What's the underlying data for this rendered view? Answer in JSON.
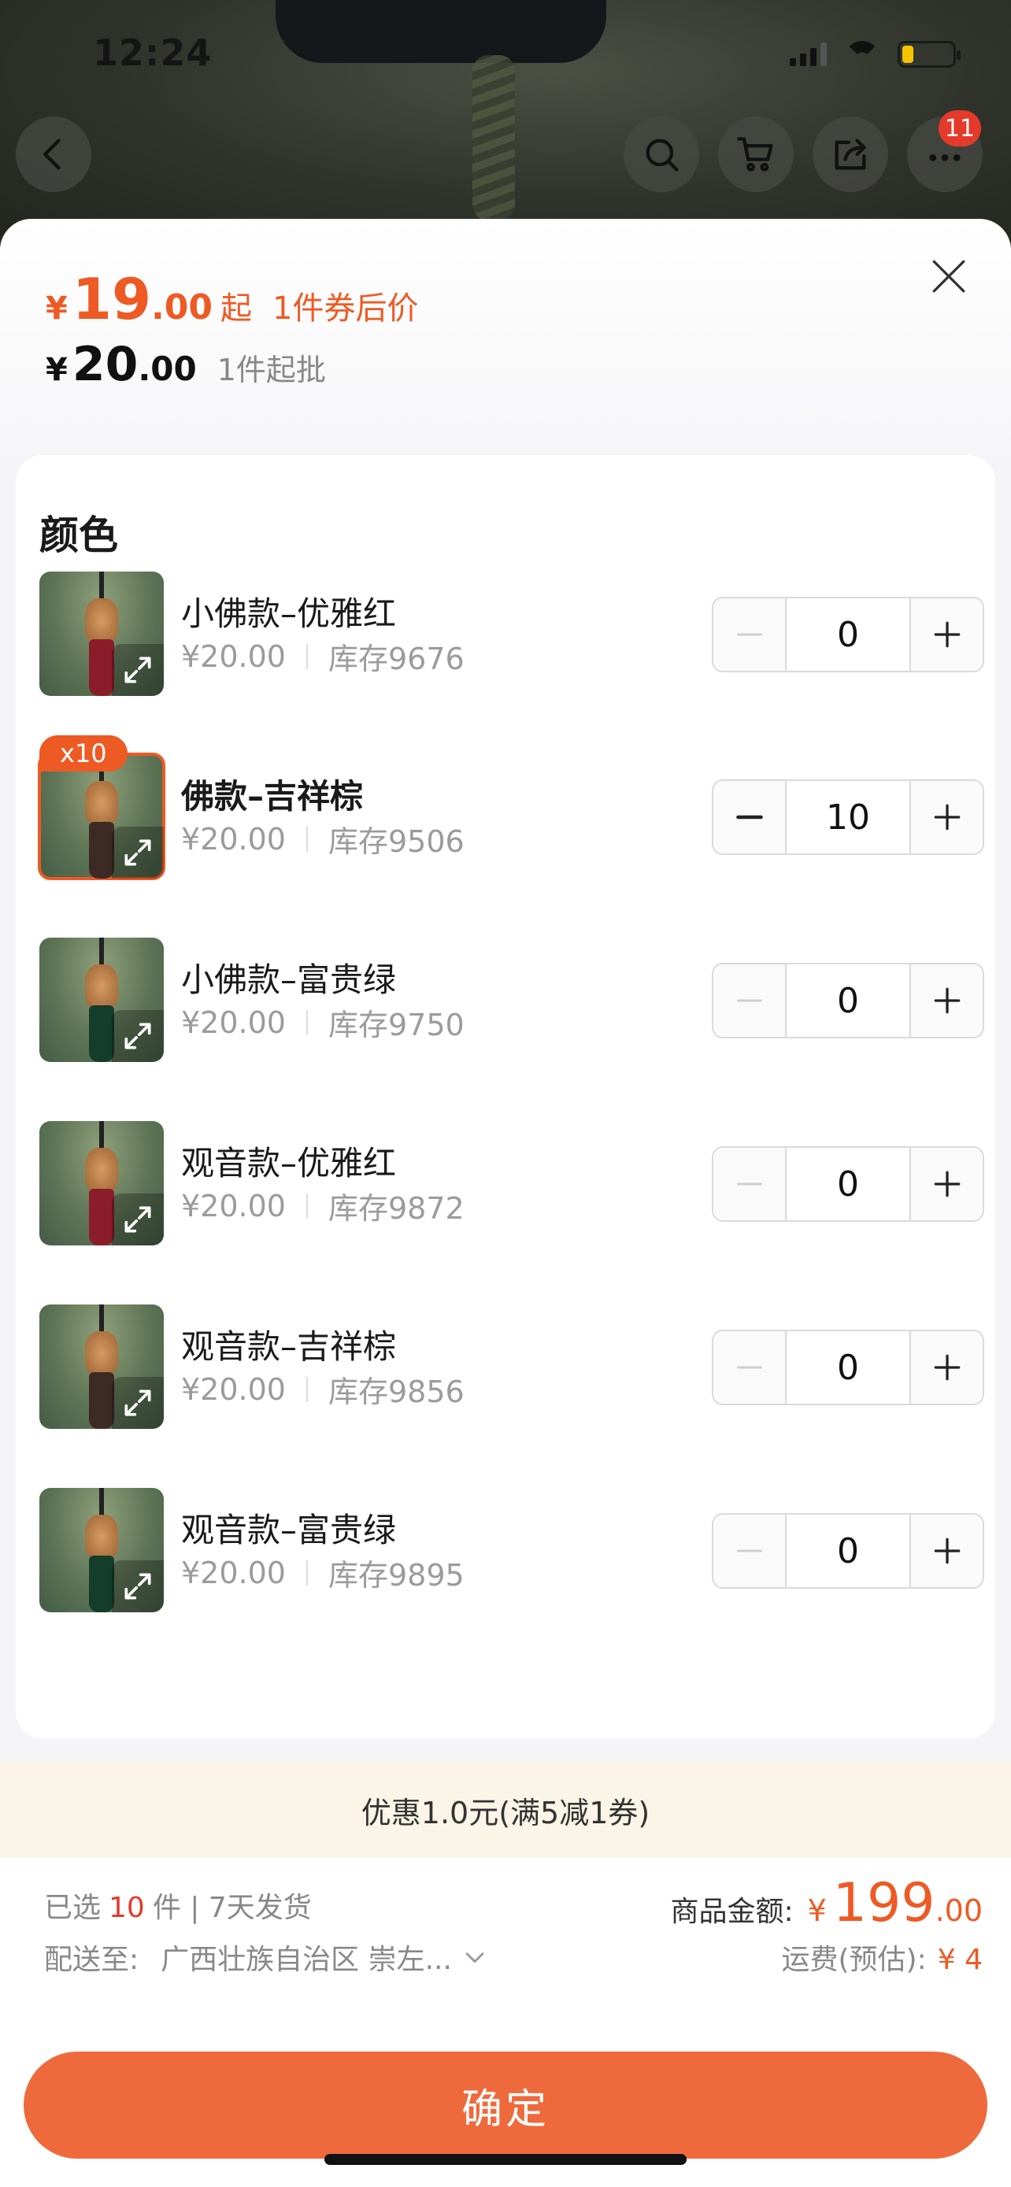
{
  "status_bar": {
    "time": "12:24"
  },
  "top_nav": {
    "back_icon": "chevron-left-icon",
    "search_icon": "search-icon",
    "cart_icon": "cart-icon",
    "share_icon": "share-icon",
    "more_badge": "11"
  },
  "sheet": {
    "price": {
      "coupon_currency": "¥",
      "coupon_integer": "19",
      "coupon_decimal": ".00",
      "coupon_qi": "起",
      "coupon_label": "1件券后价",
      "base_currency": "¥",
      "base_integer": "20",
      "base_decimal": ".00",
      "batch_label": "1件起批"
    },
    "section_title": "颜色",
    "skus": [
      {
        "name": "小佛款–优雅红",
        "price": "¥20.00",
        "stock": "库存9676",
        "qty": "0",
        "selected": false,
        "tassel": "#8b1c2a"
      },
      {
        "name": "佛款–吉祥棕",
        "price": "¥20.00",
        "stock": "库存9506",
        "qty": "10",
        "selected": true,
        "badge": "x10",
        "tassel": "#3e2a24"
      },
      {
        "name": "小佛款–富贵绿",
        "price": "¥20.00",
        "stock": "库存9750",
        "qty": "0",
        "selected": false,
        "tassel": "#143d2b"
      },
      {
        "name": "观音款–优雅红",
        "price": "¥20.00",
        "stock": "库存9872",
        "qty": "0",
        "selected": false,
        "tassel": "#8b1c2a"
      },
      {
        "name": "观音款–吉祥棕",
        "price": "¥20.00",
        "stock": "库存9856",
        "qty": "0",
        "selected": false,
        "tassel": "#3e2a24"
      },
      {
        "name": "观音款–富贵绿",
        "price": "¥20.00",
        "stock": "库存9895",
        "qty": "0",
        "selected": false,
        "tassel": "#143d2b"
      }
    ],
    "promo": "优惠1.0元(满5减1券)",
    "footer": {
      "selected_prefix": "已选",
      "selected_count": "10",
      "selected_suffix": "件 | 7天发货",
      "ship_to_label": "配送至:",
      "ship_to_address": "广西壮族自治区 崇左...",
      "amount_label": "商品金额:",
      "amount_currency": "¥",
      "amount_integer": "199",
      "amount_decimal": ".00",
      "freight_label": "运费(预估):",
      "freight_value": "¥ 4",
      "confirm_label": "确定"
    }
  },
  "colors": {
    "accent": "#ee5a24",
    "button": "#ee6a3c",
    "promo_bg": "#fbf5e7"
  }
}
